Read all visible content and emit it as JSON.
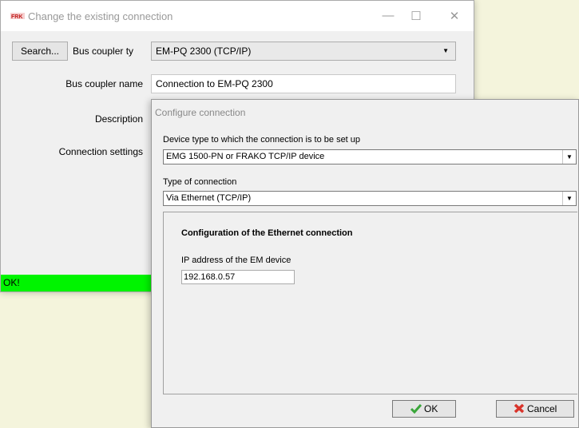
{
  "back_window": {
    "title": "Change the existing connection",
    "controls": {
      "minimize": "—",
      "maximize": "☐",
      "close": "✕"
    },
    "search_button": "Search...",
    "bus_coupler_type_label": "Bus coupler ty",
    "bus_coupler_type_value": "EM-PQ 2300 (TCP/IP)",
    "bus_coupler_name_label": "Bus coupler name",
    "bus_coupler_name_value": "Connection to EM-PQ 2300",
    "description_label": "Description",
    "connection_settings_label": "Connection settings",
    "status_text": "OK!"
  },
  "dialog": {
    "title": "Configure connection",
    "device_type_label": "Device type to which the connection is to be set up",
    "device_type_value": "EMG 1500-PN or FRAKO TCP/IP device",
    "connection_type_label": "Type of connection",
    "connection_type_value": "Via Ethernet (TCP/IP)",
    "group_title": "Configuration of the Ethernet connection",
    "ip_label": "IP address of the EM device",
    "ip_value": "192.168.0.57",
    "ok_button": "OK",
    "cancel_button": "Cancel"
  },
  "colors": {
    "status_green": "#00f400",
    "desktop_bg": "#f4f4dc",
    "ok_check": "#3aa63a",
    "cancel_x": "#d9342b"
  },
  "icons": {
    "app": "frako-logo-icon",
    "ok": "checkmark-icon",
    "cancel": "red-x-icon"
  }
}
